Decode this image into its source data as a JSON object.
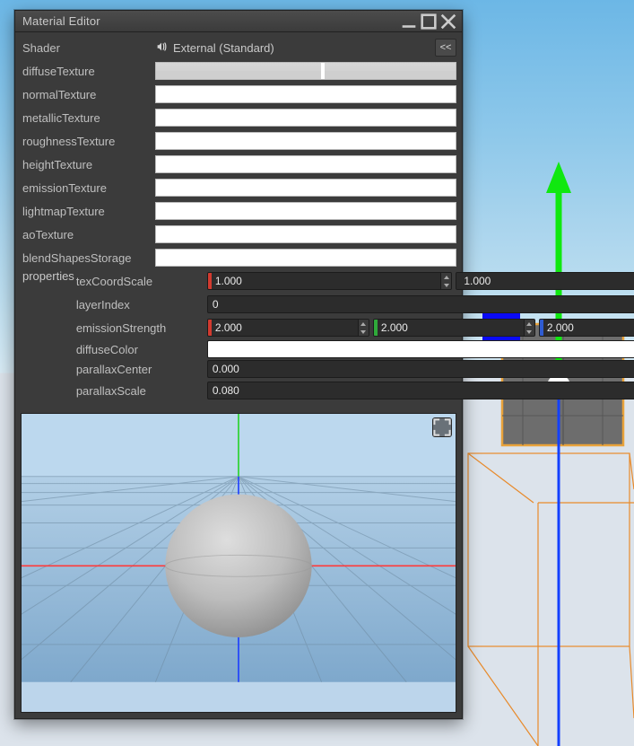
{
  "window": {
    "title": "Material Editor"
  },
  "shader": {
    "label": "Shader",
    "value": "External (Standard)"
  },
  "textureSlots": [
    {
      "key": "diffuseTexture",
      "label": "diffuseTexture",
      "kind": "diffuse"
    },
    {
      "key": "normalTexture",
      "label": "normalTexture",
      "kind": "empty"
    },
    {
      "key": "metallicTexture",
      "label": "metallicTexture",
      "kind": "empty"
    },
    {
      "key": "roughnessTexture",
      "label": "roughnessTexture",
      "kind": "empty"
    },
    {
      "key": "heightTexture",
      "label": "heightTexture",
      "kind": "empty"
    },
    {
      "key": "emissionTexture",
      "label": "emissionTexture",
      "kind": "empty"
    },
    {
      "key": "lightmapTexture",
      "label": "lightmapTexture",
      "kind": "empty"
    },
    {
      "key": "aoTexture",
      "label": "aoTexture",
      "kind": "empty"
    },
    {
      "key": "blendShapesStorage",
      "label": "blendShapesStorage",
      "kind": "empty"
    }
  ],
  "properties": {
    "label": "properties",
    "texCoordScale": {
      "label": "texCoordScale",
      "x": "1.000",
      "y": "1.000"
    },
    "layerIndex": {
      "label": "layerIndex",
      "value": "0"
    },
    "emissionStrength": {
      "label": "emissionStrength",
      "r": "2.000",
      "g": "2.000",
      "b": "2.000"
    },
    "diffuseColor": {
      "label": "diffuseColor",
      "hex": "#ffffff"
    },
    "parallaxCenter": {
      "label": "parallaxCenter",
      "value": "0.000"
    },
    "parallaxScale": {
      "label": "parallaxScale",
      "value": "0.080"
    }
  },
  "icons": {
    "back": "<<"
  }
}
